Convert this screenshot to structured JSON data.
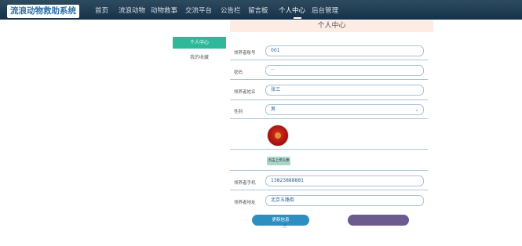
{
  "nav": {
    "logo": "流浪动物救助系统",
    "items": [
      {
        "label": "首页"
      },
      {
        "label": "流浪动物"
      },
      {
        "label": "动物救事"
      },
      {
        "label": "交流平台"
      },
      {
        "label": "公告栏"
      },
      {
        "label": "留言板"
      },
      {
        "label": "个人中心"
      },
      {
        "label": "后台管理"
      }
    ],
    "active_index": 6
  },
  "page": {
    "title": "个人中心"
  },
  "side_menu": {
    "items": [
      {
        "label": "个人中心"
      },
      {
        "label": "我的收藏"
      }
    ]
  },
  "form": {
    "fields": {
      "account": {
        "label": "领养者账号",
        "value": "001"
      },
      "password": {
        "label": "密码",
        "value": "···"
      },
      "name": {
        "label": "领养者姓名",
        "value": "张三"
      },
      "gender": {
        "label": "性别",
        "value": "男"
      },
      "phone": {
        "label": "领养者手机",
        "value": "13823888881"
      },
      "address": {
        "label": "领养者地址",
        "value": "北京五路街"
      }
    },
    "upload_label": "点击上传头像"
  },
  "actions": {
    "save_label": "更新信息",
    "logout_label": ""
  },
  "colors": {
    "nav_bg": "#1f3b52",
    "accent_green": "#2fb99a",
    "save_btn": "#2c8fbf",
    "logout_btn": "#6b5b8f"
  }
}
